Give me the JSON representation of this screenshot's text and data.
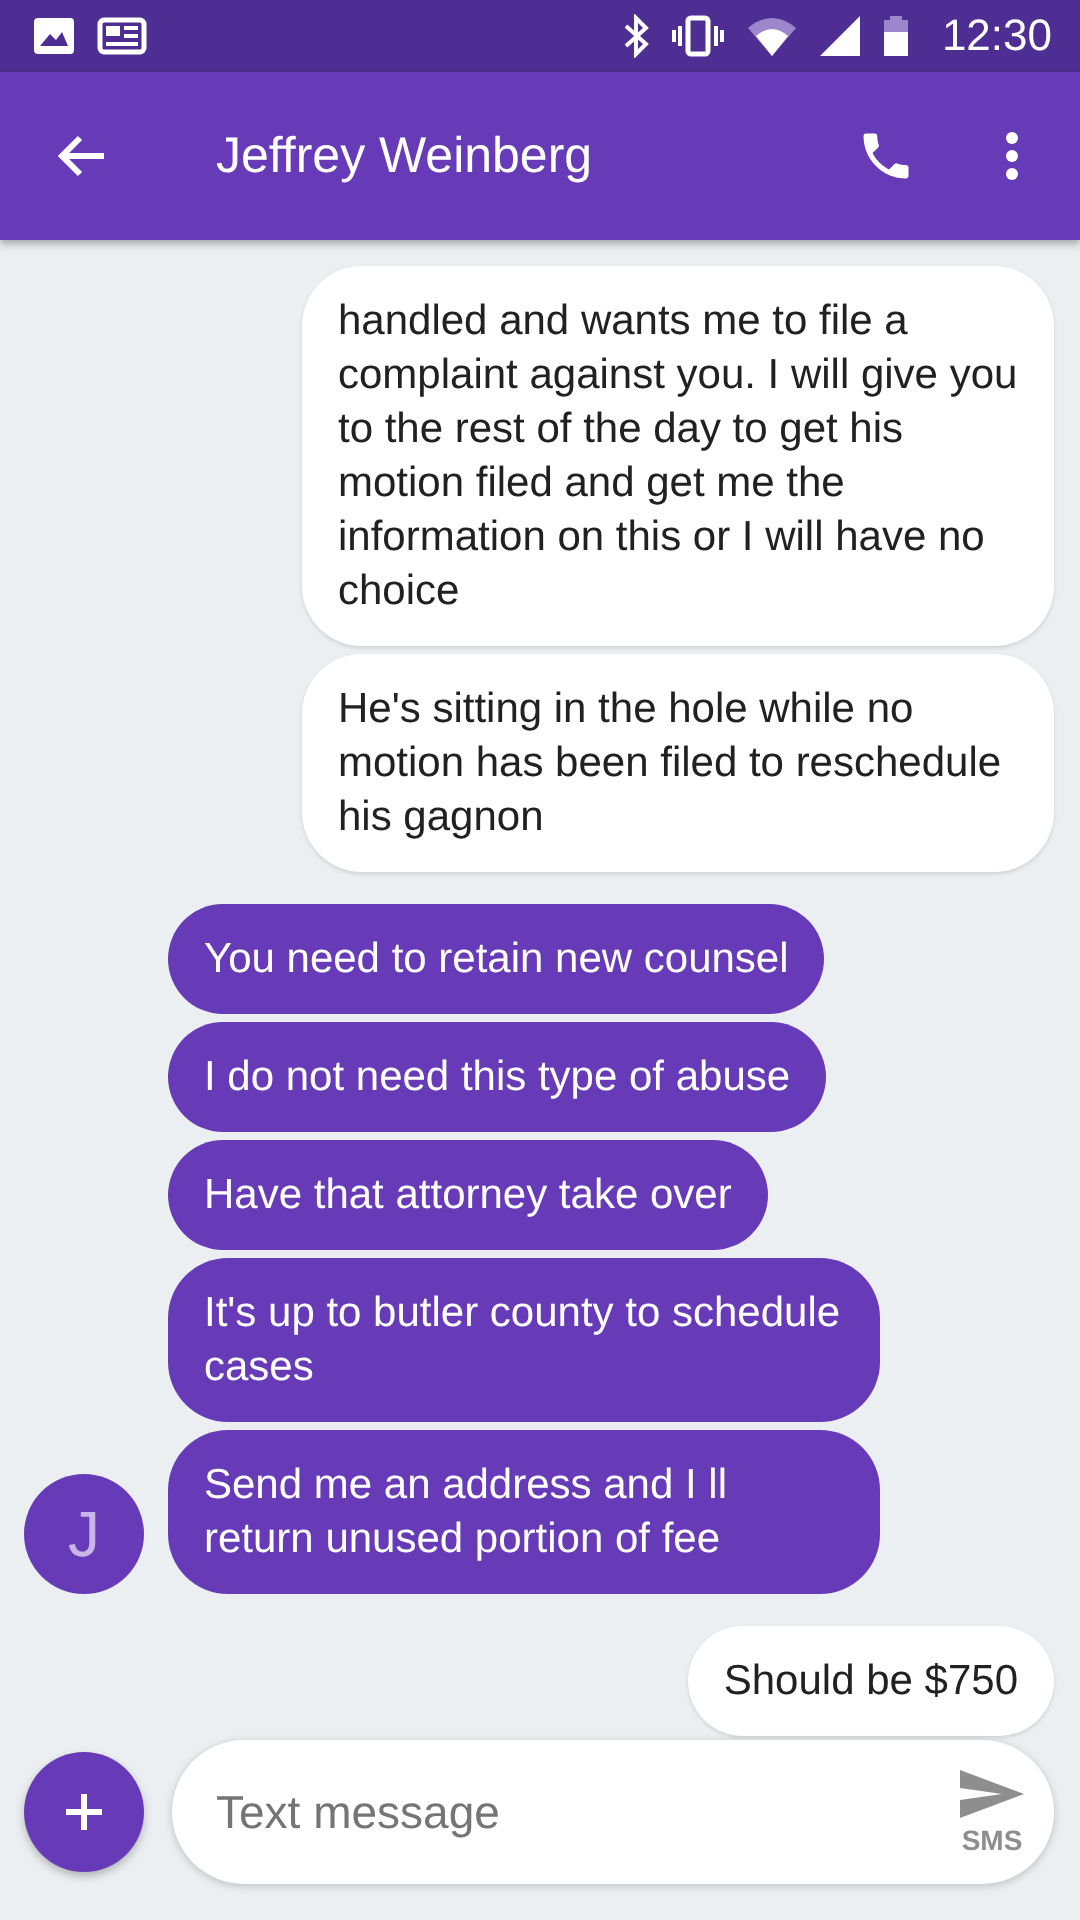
{
  "status_bar": {
    "time": "12:30"
  },
  "app_bar": {
    "title": "Jeffrey Weinberg"
  },
  "messages": [
    {
      "kind": "outgoing",
      "text": "handled and wants me to file a complaint against you. I will give you to the rest of the day to get his motion filed and get me the information on this or I will have no choice"
    },
    {
      "kind": "outgoing",
      "text": "He's sitting in the hole while no motion has been filed to reschedule his gagnon"
    },
    {
      "kind": "incoming",
      "text": "You need to retain new counsel"
    },
    {
      "kind": "incoming",
      "text": "I do not need this type of abuse"
    },
    {
      "kind": "incoming",
      "text": "Have that attorney take over"
    },
    {
      "kind": "incoming",
      "text": "It's up to butler county to schedule cases"
    },
    {
      "kind": "incoming",
      "text": "Send me an address and I ll return unused portion of fee",
      "avatar": "J"
    },
    {
      "kind": "outgoing",
      "text": "Should be $750"
    }
  ],
  "composer": {
    "placeholder": "Text message",
    "send_label": "SMS"
  }
}
